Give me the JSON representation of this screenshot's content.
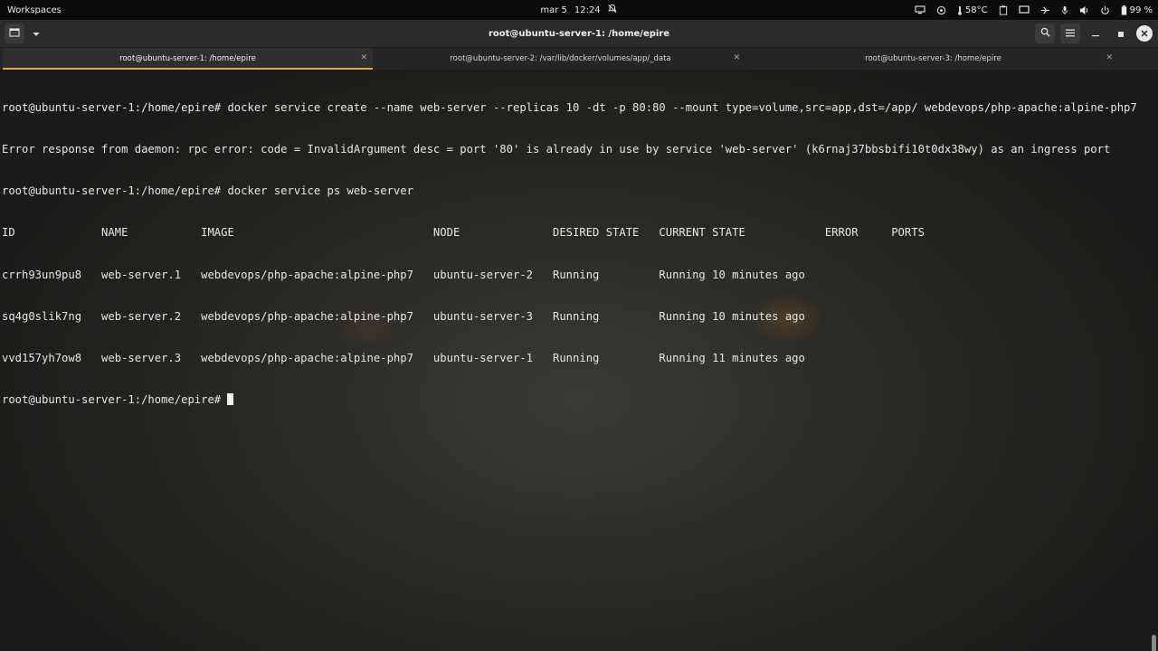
{
  "topbar": {
    "workspaces_label": "Workspaces",
    "date": "mar 5",
    "time": "12:24",
    "temperature": "58°C",
    "battery": "99 %"
  },
  "window": {
    "title": "root@ubuntu-server-1: /home/epire",
    "tabs": [
      {
        "label": "root@ubuntu-server-1: /home/epire",
        "active": true
      },
      {
        "label": "root@ubuntu-server-2: /var/lib/docker/volumes/app/_data",
        "active": false
      },
      {
        "label": "root@ubuntu-server-3: /home/epire",
        "active": false
      }
    ]
  },
  "terminal": {
    "lines": [
      "root@ubuntu-server-1:/home/epire# docker service create --name web-server --replicas 10 -dt -p 80:80 --mount type=volume,src=app,dst=/app/ webdevops/php-apache:alpine-php7",
      "Error response from daemon: rpc error: code = InvalidArgument desc = port '80' is already in use by service 'web-server' (k6rnaj37bbsbifi10t0dx38wy) as an ingress port",
      "root@ubuntu-server-1:/home/epire# docker service ps web-server",
      "ID             NAME           IMAGE                              NODE              DESIRED STATE   CURRENT STATE            ERROR     PORTS",
      "crrh93un9pu8   web-server.1   webdevops/php-apache:alpine-php7   ubuntu-server-2   Running         Running 10 minutes ago",
      "sq4g0slik7ng   web-server.2   webdevops/php-apache:alpine-php7   ubuntu-server-3   Running         Running 10 minutes ago",
      "vvd157yh7ow8   web-server.3   webdevops/php-apache:alpine-php7   ubuntu-server-1   Running         Running 11 minutes ago"
    ],
    "prompt": "root@ubuntu-server-1:/home/epire# "
  },
  "colors": {
    "accent": "#e2a43a",
    "terminal_text": "#e6e6e6"
  },
  "icons": [
    "new-tab-icon",
    "dropdown-icon",
    "search-icon",
    "menu-icon",
    "minimize-icon",
    "maximize-icon",
    "close-icon",
    "do-not-disturb-icon",
    "display-icon",
    "cpu-icon",
    "temperature-icon",
    "clipboard-icon",
    "screen-icon",
    "airplane-icon",
    "microphone-icon",
    "volume-icon",
    "power-icon",
    "battery-icon"
  ]
}
